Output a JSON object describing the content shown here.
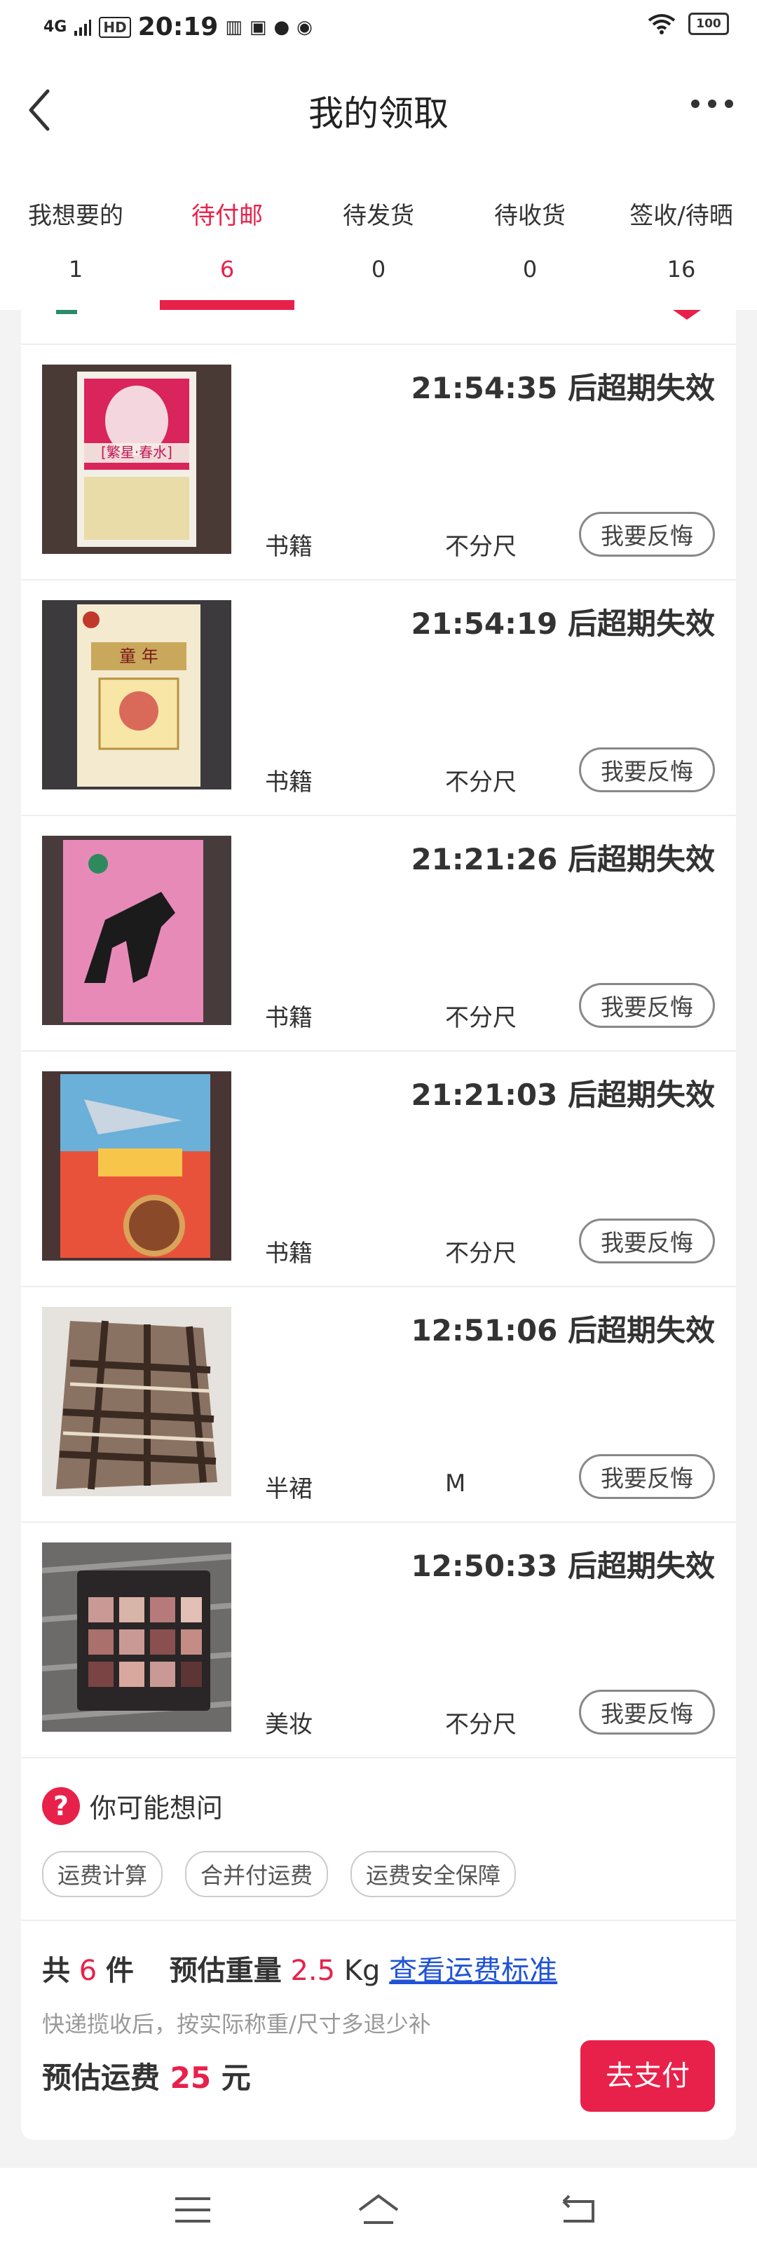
{
  "status_bar": {
    "network": "4G",
    "hd": "HD",
    "time": "20:19",
    "battery": "100",
    "icons": [
      "signal-icon",
      "book-icon",
      "iqiyi-icon",
      "wechat-icon",
      "compass-icon",
      "wifi-icon",
      "battery-icon"
    ]
  },
  "header": {
    "title": "我的领取",
    "back_icon": "chevron-left-icon",
    "more_icon": "more-dots-icon"
  },
  "tabs": [
    {
      "label": "我想要的",
      "count": "1",
      "active": false
    },
    {
      "label": "待付邮",
      "count": "6",
      "active": true
    },
    {
      "label": "待发货",
      "count": "0",
      "active": false
    },
    {
      "label": "待收货",
      "count": "0",
      "active": false
    },
    {
      "label": "签收/待晒",
      "count": "16",
      "active": false
    }
  ],
  "items": [
    {
      "timer": "21:54:35 后超期失效",
      "category": "书籍",
      "size": "不分尺",
      "action": "我要反悔",
      "thumb": "book-cover-fanxing-chunshui"
    },
    {
      "timer": "21:54:19 后超期失效",
      "category": "书籍",
      "size": "不分尺",
      "action": "我要反悔",
      "thumb": "book-cover-tongnian"
    },
    {
      "timer": "21:21:26 后超期失效",
      "category": "书籍",
      "size": "不分尺",
      "action": "我要反悔",
      "thumb": "book-cover-horse"
    },
    {
      "timer": "21:21:03 后超期失效",
      "category": "书籍",
      "size": "不分尺",
      "action": "我要反悔",
      "thumb": "book-cover-haidi-liangwanli"
    },
    {
      "timer": "12:51:06 后超期失效",
      "category": "半裙",
      "size": "M",
      "action": "我要反悔",
      "thumb": "plaid-skirt"
    },
    {
      "timer": "12:50:33 后超期失效",
      "category": "美妆",
      "size": "不分尺",
      "action": "我要反悔",
      "thumb": "eyeshadow-palette"
    }
  ],
  "suggest": {
    "title": "你可能想问",
    "chips": [
      "运费计算",
      "合并付运费",
      "运费安全保障"
    ]
  },
  "summary": {
    "count_prefix": "共",
    "count": "6",
    "count_suffix": "件",
    "weight_label": "预估重量",
    "weight": "2.5",
    "weight_unit": "Kg",
    "link": "查看运费标准",
    "note": "快递揽收后，按实际称重/尺寸多退少补",
    "fee_label": "预估运费",
    "fee": "25",
    "fee_unit": "元",
    "pay_button": "去支付"
  },
  "colors": {
    "accent": "#e8214a",
    "link": "#2153d6"
  }
}
